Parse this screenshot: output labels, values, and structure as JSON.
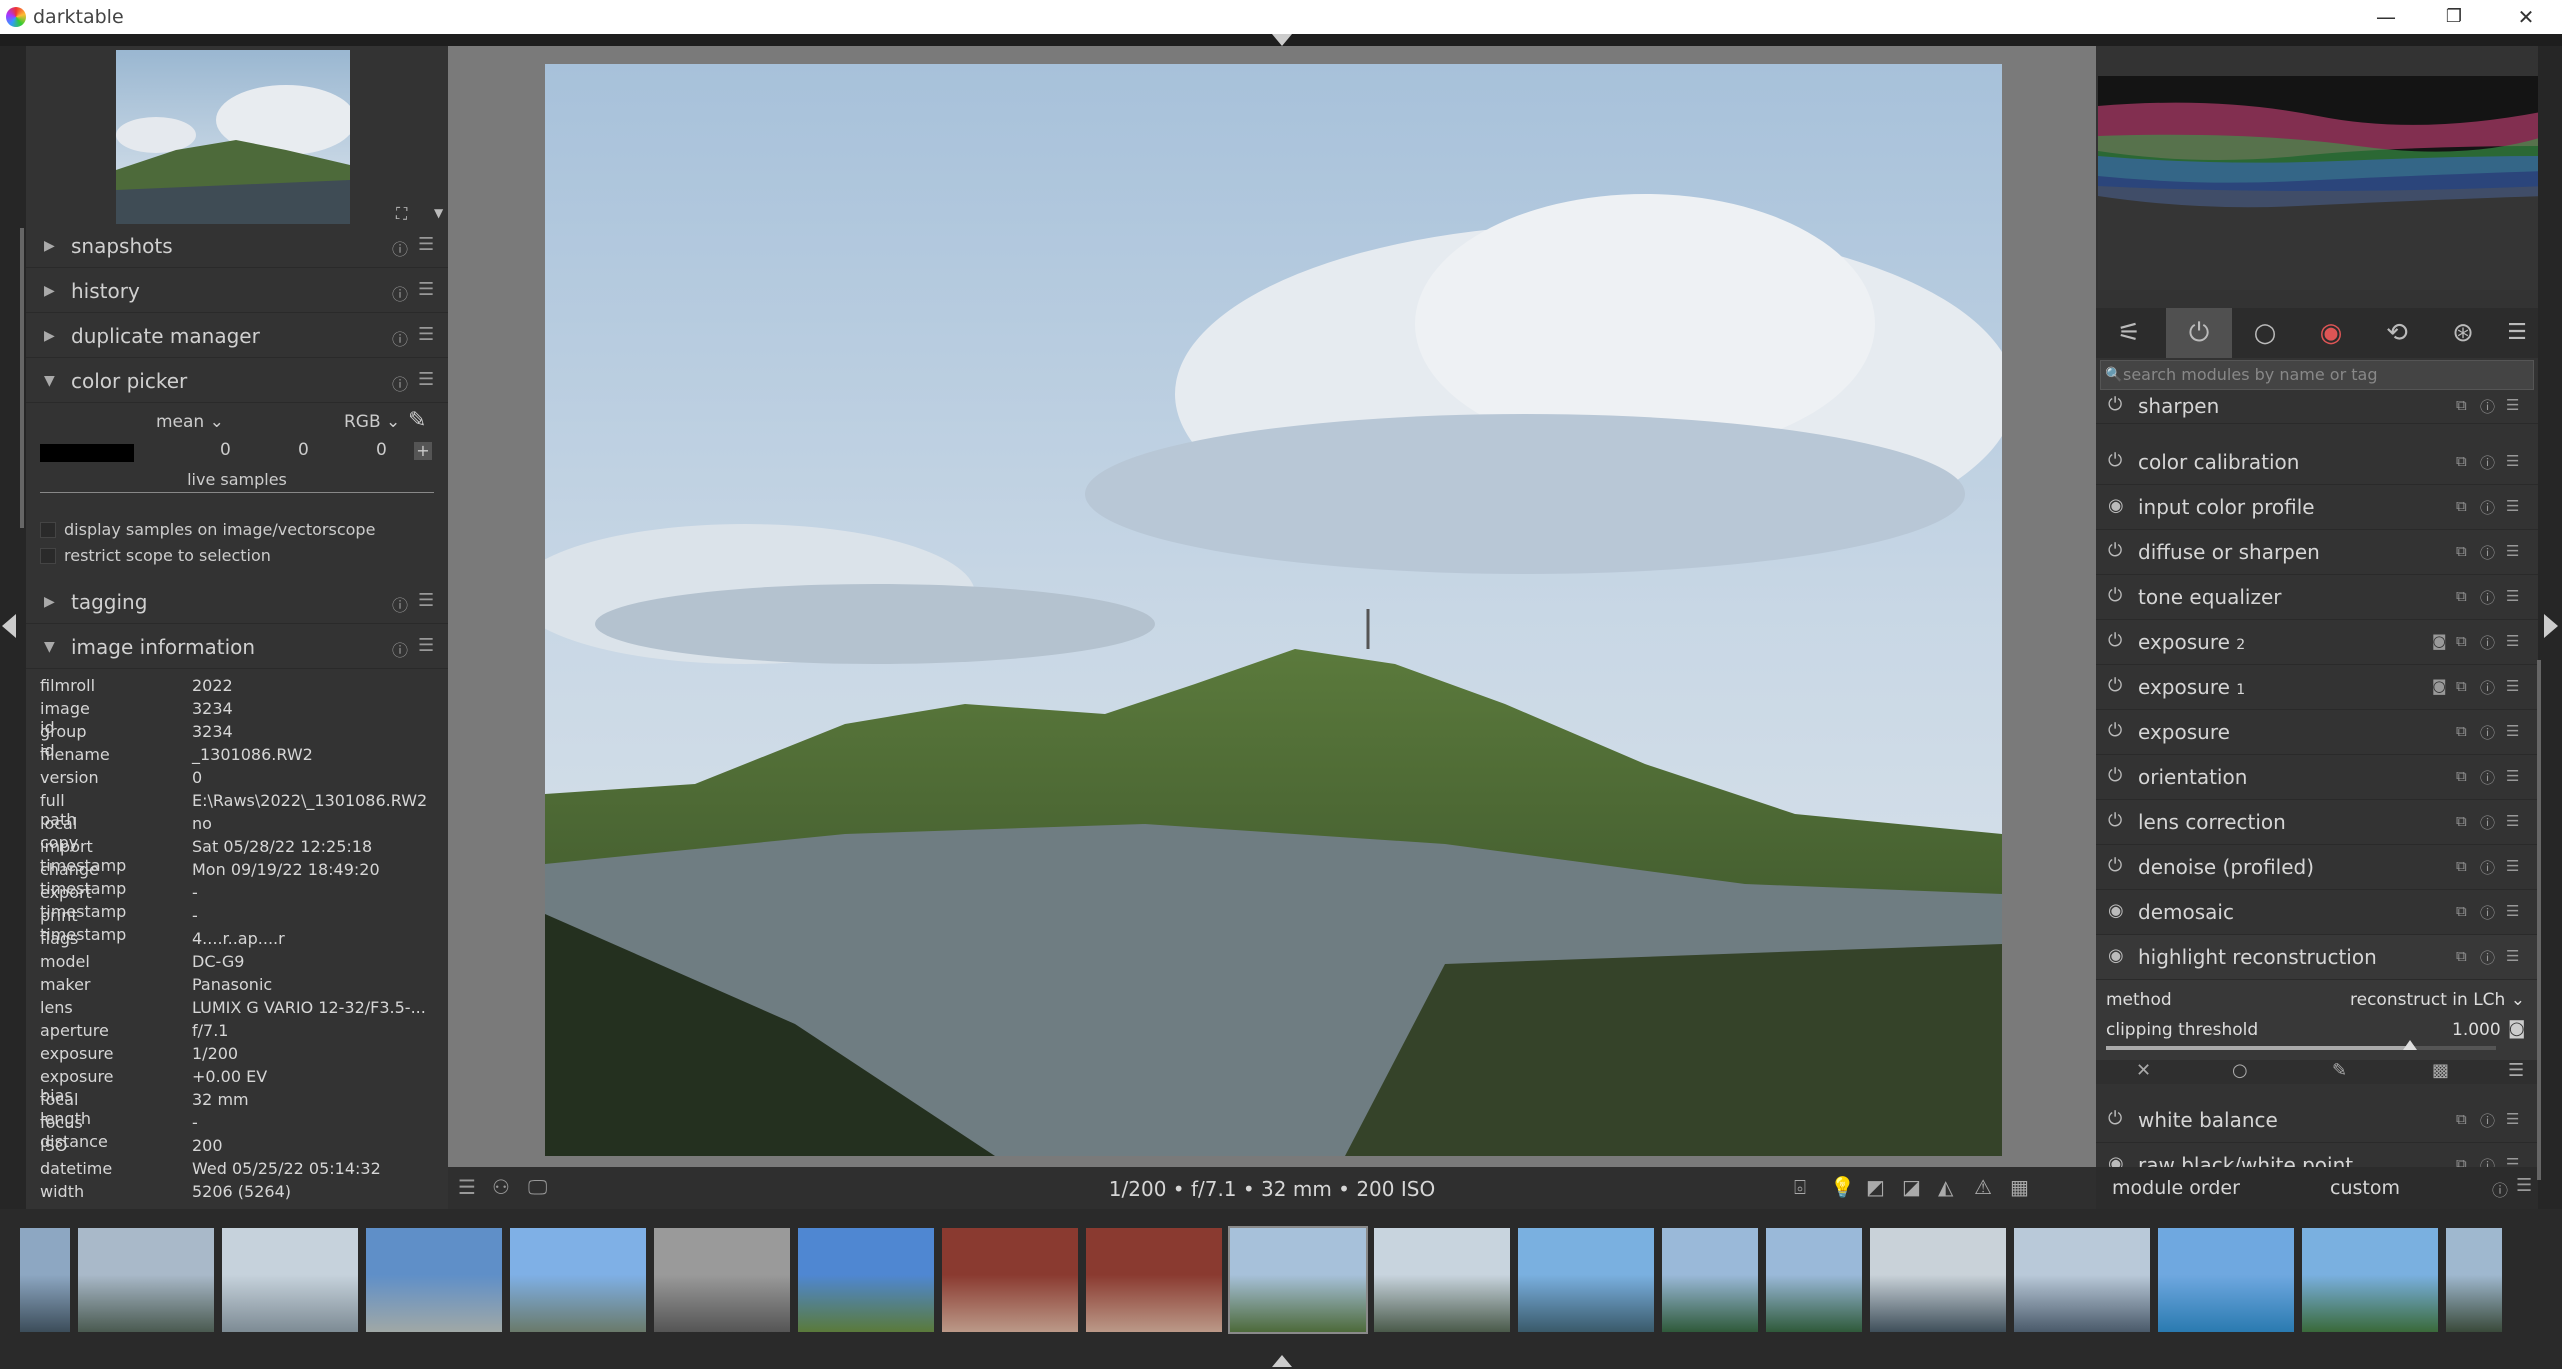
{
  "window": {
    "title": "darktable",
    "minimize": "—",
    "maximize": "❐",
    "close": "✕"
  },
  "left": {
    "modules": {
      "snapshots": "snapshots",
      "history": "history",
      "duplicate_manager": "duplicate manager",
      "color_picker": "color picker",
      "tagging": "tagging",
      "image_information": "image information"
    },
    "color_picker": {
      "mode": "mean",
      "colorspace": "RGB",
      "values": [
        "0",
        "0",
        "0"
      ],
      "live_samples": "live samples",
      "display_samples": "display samples on image/vectorscope",
      "restrict_scope": "restrict scope to selection"
    },
    "image_info": [
      {
        "k": "filmroll",
        "v": "2022"
      },
      {
        "k": "image id",
        "v": "3234"
      },
      {
        "k": "group id",
        "v": "3234"
      },
      {
        "k": "filename",
        "v": "_1301086.RW2"
      },
      {
        "k": "version",
        "v": "0"
      },
      {
        "k": "full path",
        "v": "E:\\Raws\\2022\\_1301086.RW2"
      },
      {
        "k": "local copy",
        "v": "no"
      },
      {
        "k": "import timestamp",
        "v": "Sat 05/28/22 12:25:18"
      },
      {
        "k": "change timestamp",
        "v": "Mon 09/19/22 18:49:20"
      },
      {
        "k": "export timestamp",
        "v": "-"
      },
      {
        "k": "print timestamp",
        "v": "-"
      },
      {
        "k": "flags",
        "v": "4....r..ap....r"
      },
      {
        "k": "model",
        "v": "DC-G9"
      },
      {
        "k": "maker",
        "v": "Panasonic"
      },
      {
        "k": "lens",
        "v": "LUMIX G VARIO 12-32/F3.5-..."
      },
      {
        "k": "aperture",
        "v": "f/7.1"
      },
      {
        "k": "exposure",
        "v": "1/200"
      },
      {
        "k": "exposure bias",
        "v": "+0.00 EV"
      },
      {
        "k": "focal length",
        "v": "32 mm"
      },
      {
        "k": "focus distance",
        "v": "-"
      },
      {
        "k": "ISO",
        "v": "200"
      },
      {
        "k": "datetime",
        "v": "Wed 05/25/22 05:14:32"
      },
      {
        "k": "width",
        "v": "5206 (5264)"
      }
    ]
  },
  "center": {
    "exif_line": "1/200 • f/7.1 • 32 mm • 200 ISO"
  },
  "right": {
    "search_placeholder": "search modules by name or tag",
    "modules": {
      "sharpen": "sharpen",
      "color_calibration": "color calibration",
      "input_color_profile": "input color profile",
      "diffuse": "diffuse or sharpen",
      "tone_eq": "tone equalizer",
      "exposure2": "exposure",
      "exposure2_num": "2",
      "exposure1": "exposure",
      "exposure1_num": "1",
      "exposure": "exposure",
      "orientation": "orientation",
      "lens": "lens correction",
      "denoise": "denoise (profiled)",
      "demosaic": "demosaic",
      "highlight": "highlight reconstruction",
      "white_balance": "white balance",
      "raw_bw": "raw black/white point"
    },
    "highlight": {
      "method_label": "method",
      "method_value": "reconstruct in LCh",
      "clip_label": "clipping threshold",
      "clip_value": "1.000",
      "clip_fraction": 0.78
    },
    "module_order_label": "module order",
    "module_order_value": "custom"
  },
  "colors": {
    "accent_sel": "#8a8a8a",
    "panel": "#333333"
  }
}
